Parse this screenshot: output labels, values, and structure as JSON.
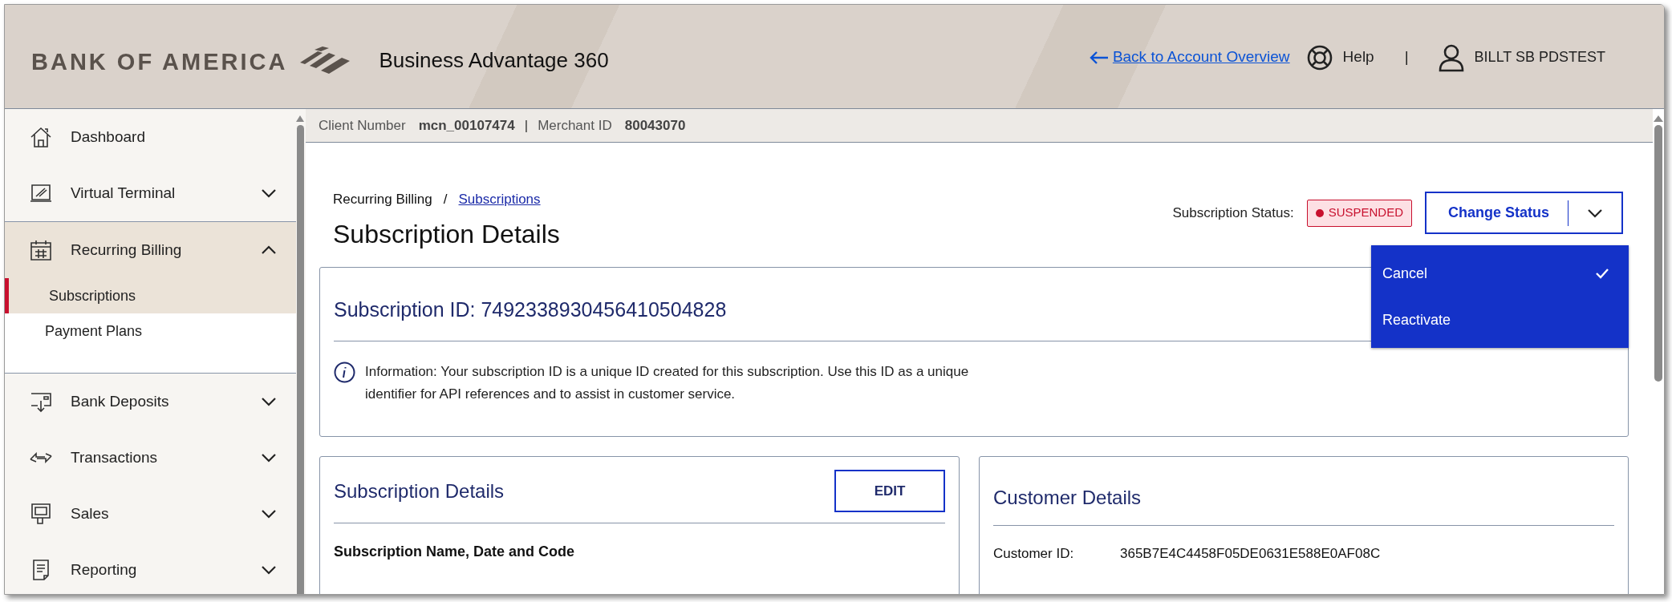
{
  "header": {
    "brand": "BANK OF AMERICA",
    "product": "Business Advantage 360",
    "back_link": "Back to Account Overview",
    "help": "Help",
    "separator": "|",
    "user": "BILLT SB PDSTEST"
  },
  "sidebar": {
    "items": [
      {
        "label": "Dashboard",
        "kind": "link",
        "expanded": false
      },
      {
        "label": "Virtual Terminal",
        "kind": "group",
        "expanded": false
      },
      {
        "label": "Recurring Billing",
        "kind": "group",
        "expanded": true,
        "children": [
          {
            "label": "Subscriptions",
            "selected": true
          },
          {
            "label": "Payment Plans",
            "selected": false
          }
        ]
      },
      {
        "label": "Bank Deposits",
        "kind": "group",
        "expanded": false
      },
      {
        "label": "Transactions",
        "kind": "group",
        "expanded": false
      },
      {
        "label": "Sales",
        "kind": "group",
        "expanded": false
      },
      {
        "label": "Reporting",
        "kind": "group",
        "expanded": false
      }
    ]
  },
  "client_bar": {
    "fields": [
      {
        "label": "Client Number",
        "value": "mcn_00107474"
      },
      {
        "label": "Merchant ID",
        "value": "80043070"
      }
    ],
    "separator": "|"
  },
  "breadcrumb": {
    "parent": "Recurring Billing",
    "separator": "/",
    "current": "Subscriptions"
  },
  "page_title": "Subscription Details",
  "status": {
    "label": "Subscription Status:",
    "badge": "SUSPENDED",
    "color": "#c8102e",
    "button": "Change Status",
    "menu_open": true,
    "menu": [
      {
        "label": "Cancel",
        "checked": true
      },
      {
        "label": "Reactivate",
        "checked": false
      }
    ]
  },
  "id_card": {
    "title": "Subscription ID: 7492338930456410504828",
    "info": "Information: Your subscription ID is a unique ID created for this subscription. Use this ID as a unique identifier for API references and to assist in customer service."
  },
  "subscription_card": {
    "title": "Subscription Details",
    "button": "EDIT",
    "section": "Subscription Name, Date and Code"
  },
  "customer_card": {
    "title": "Customer Details",
    "fields": [
      {
        "label": "Customer ID:",
        "value": "365B7E4C4458F05DE0631E588E0AF08C"
      }
    ]
  }
}
